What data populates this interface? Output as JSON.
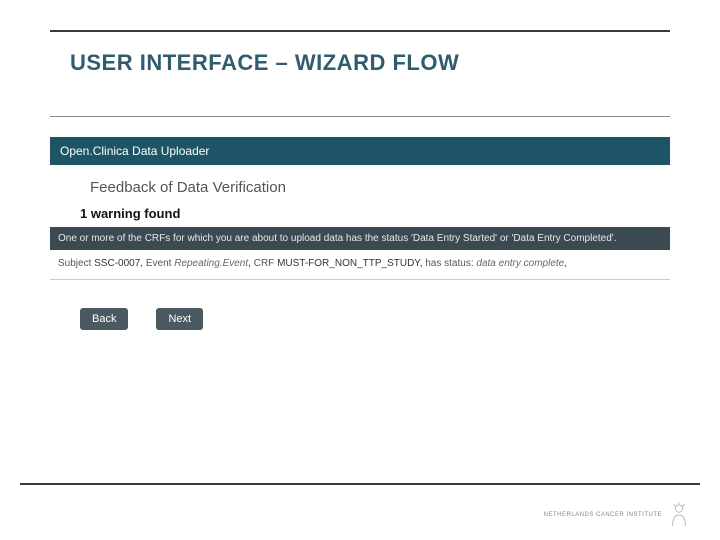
{
  "slide": {
    "title": "USER INTERFACE – WIZARD FLOW"
  },
  "app": {
    "header": "Open.Clinica Data Uploader",
    "section_title": "Feedback of Data Verification",
    "warning_count": "1 warning found",
    "warning_text": "One or more of the CRFs for which you are about to upload data has the status 'Data Entry Started' or 'Data Entry Completed'.",
    "detail": {
      "subject_label": "Subject",
      "subject_value": "SSC-0007",
      "event_label": "Event",
      "event_value": "Repeating.Event",
      "crf_label": "CRF",
      "crf_value": "MUST-FOR_NON_TTP_STUDY",
      "status_label": "has status:",
      "status_value": "data entry complete"
    },
    "buttons": {
      "back": "Back",
      "next": "Next"
    }
  },
  "footer": {
    "org": "NETHERLANDS CANCER INSTITUTE"
  }
}
